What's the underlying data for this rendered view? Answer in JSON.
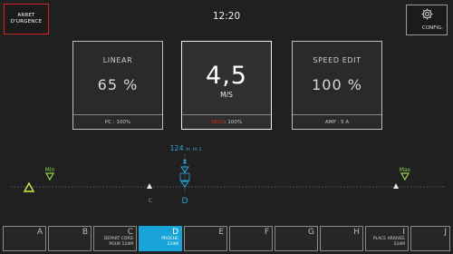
{
  "header": {
    "estop_line1": "ARRET",
    "estop_line2": "D'URGENCE",
    "time": "12:20",
    "config_label": "CONFIG."
  },
  "cards": {
    "linear": {
      "title": "LINEAR",
      "value": "65 %",
      "footer": "PC : 100%"
    },
    "speed": {
      "value": "4,5",
      "unit": "M/S",
      "footer_warn": "SECU",
      "footer_rest": " : 100%"
    },
    "speed_edit": {
      "title": "SPEED EDIT",
      "value": "100 %",
      "footer": "AMP : 5 A"
    }
  },
  "track": {
    "min_label": "Min",
    "max_label": "Max",
    "position_value": "124",
    "position_unit": "m",
    "position_extra": "to 1",
    "marker_c": "C",
    "marker_d": "D",
    "colors": {
      "min_max": "#8fd14f",
      "left_warn": "#e3e04a",
      "current": "#2aa7d8"
    }
  },
  "toolbar": {
    "keys": [
      {
        "key": "A",
        "sub": ""
      },
      {
        "key": "B",
        "sub": ""
      },
      {
        "key": "C",
        "sub": "DEPART CORD\nPOUR 124M"
      },
      {
        "key": "D",
        "sub": "PROCHE\n124M"
      },
      {
        "key": "E",
        "sub": ""
      },
      {
        "key": "F",
        "sub": ""
      },
      {
        "key": "G",
        "sub": ""
      },
      {
        "key": "H",
        "sub": ""
      },
      {
        "key": "I",
        "sub": "PLACE ARRIVEE\n224M"
      },
      {
        "key": "J",
        "sub": ""
      }
    ],
    "selected_index": 3
  }
}
